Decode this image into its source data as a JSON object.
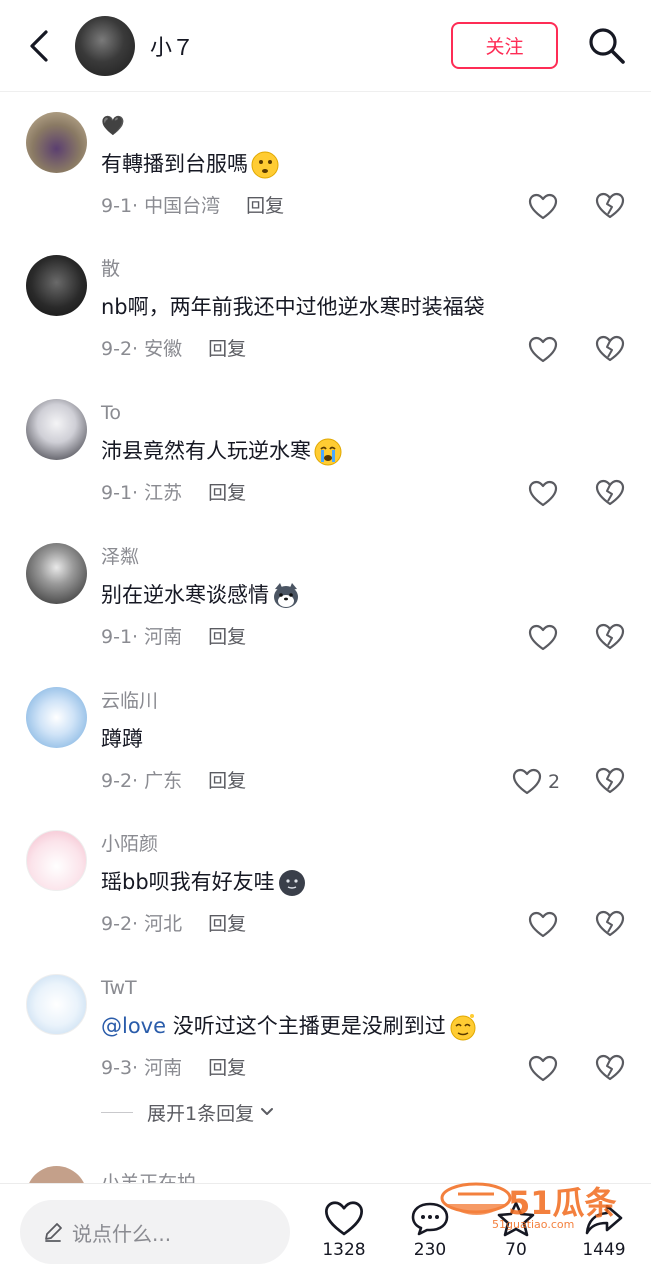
{
  "header": {
    "user_name": "小７",
    "follow_label": "关注"
  },
  "comments": [
    {
      "user": "🖤",
      "text": "有轉播到台服嗎",
      "date": "9-1",
      "location": "中国台湾",
      "reply": "回复",
      "likes": ""
    },
    {
      "user": "散",
      "text": "nb啊，两年前我还中过他逆水寒时装福袋",
      "date": "9-2",
      "location": "安徽",
      "reply": "回复",
      "likes": ""
    },
    {
      "user": "To",
      "text": "沛县竟然有人玩逆水寒",
      "date": "9-1",
      "location": "江苏",
      "reply": "回复",
      "likes": ""
    },
    {
      "user": "泽粼",
      "text": "别在逆水寒谈感情",
      "date": "9-1",
      "location": "河南",
      "reply": "回复",
      "likes": ""
    },
    {
      "user": "云临川",
      "text": "蹲蹲",
      "date": "9-2",
      "location": "广东",
      "reply": "回复",
      "likes": "2"
    },
    {
      "user": "小陌颜",
      "text": "瑶bb呗我有好友哇",
      "date": "9-2",
      "location": "河北",
      "reply": "回复",
      "likes": ""
    },
    {
      "user": "TwT",
      "mention": "@love",
      "text": " 没听过这个主播更是没刷到过",
      "date": "9-3",
      "location": "河南",
      "reply": "回复",
      "likes": ""
    }
  ],
  "expand_label": "展开1条回复",
  "partial_user": "小羊正在拍",
  "bottom_bar": {
    "input_placeholder": "说点什么...",
    "like_count": "1328",
    "comment_count": "230",
    "star_count": "70",
    "share_count": "1449"
  },
  "watermark": {
    "brand": "51瓜条",
    "site": "51guatiao.com"
  },
  "colors": {
    "accent": "#fe2c55",
    "mention": "#2a5caa",
    "muted": "#8a8b91",
    "watermark": "#f26b1d"
  }
}
